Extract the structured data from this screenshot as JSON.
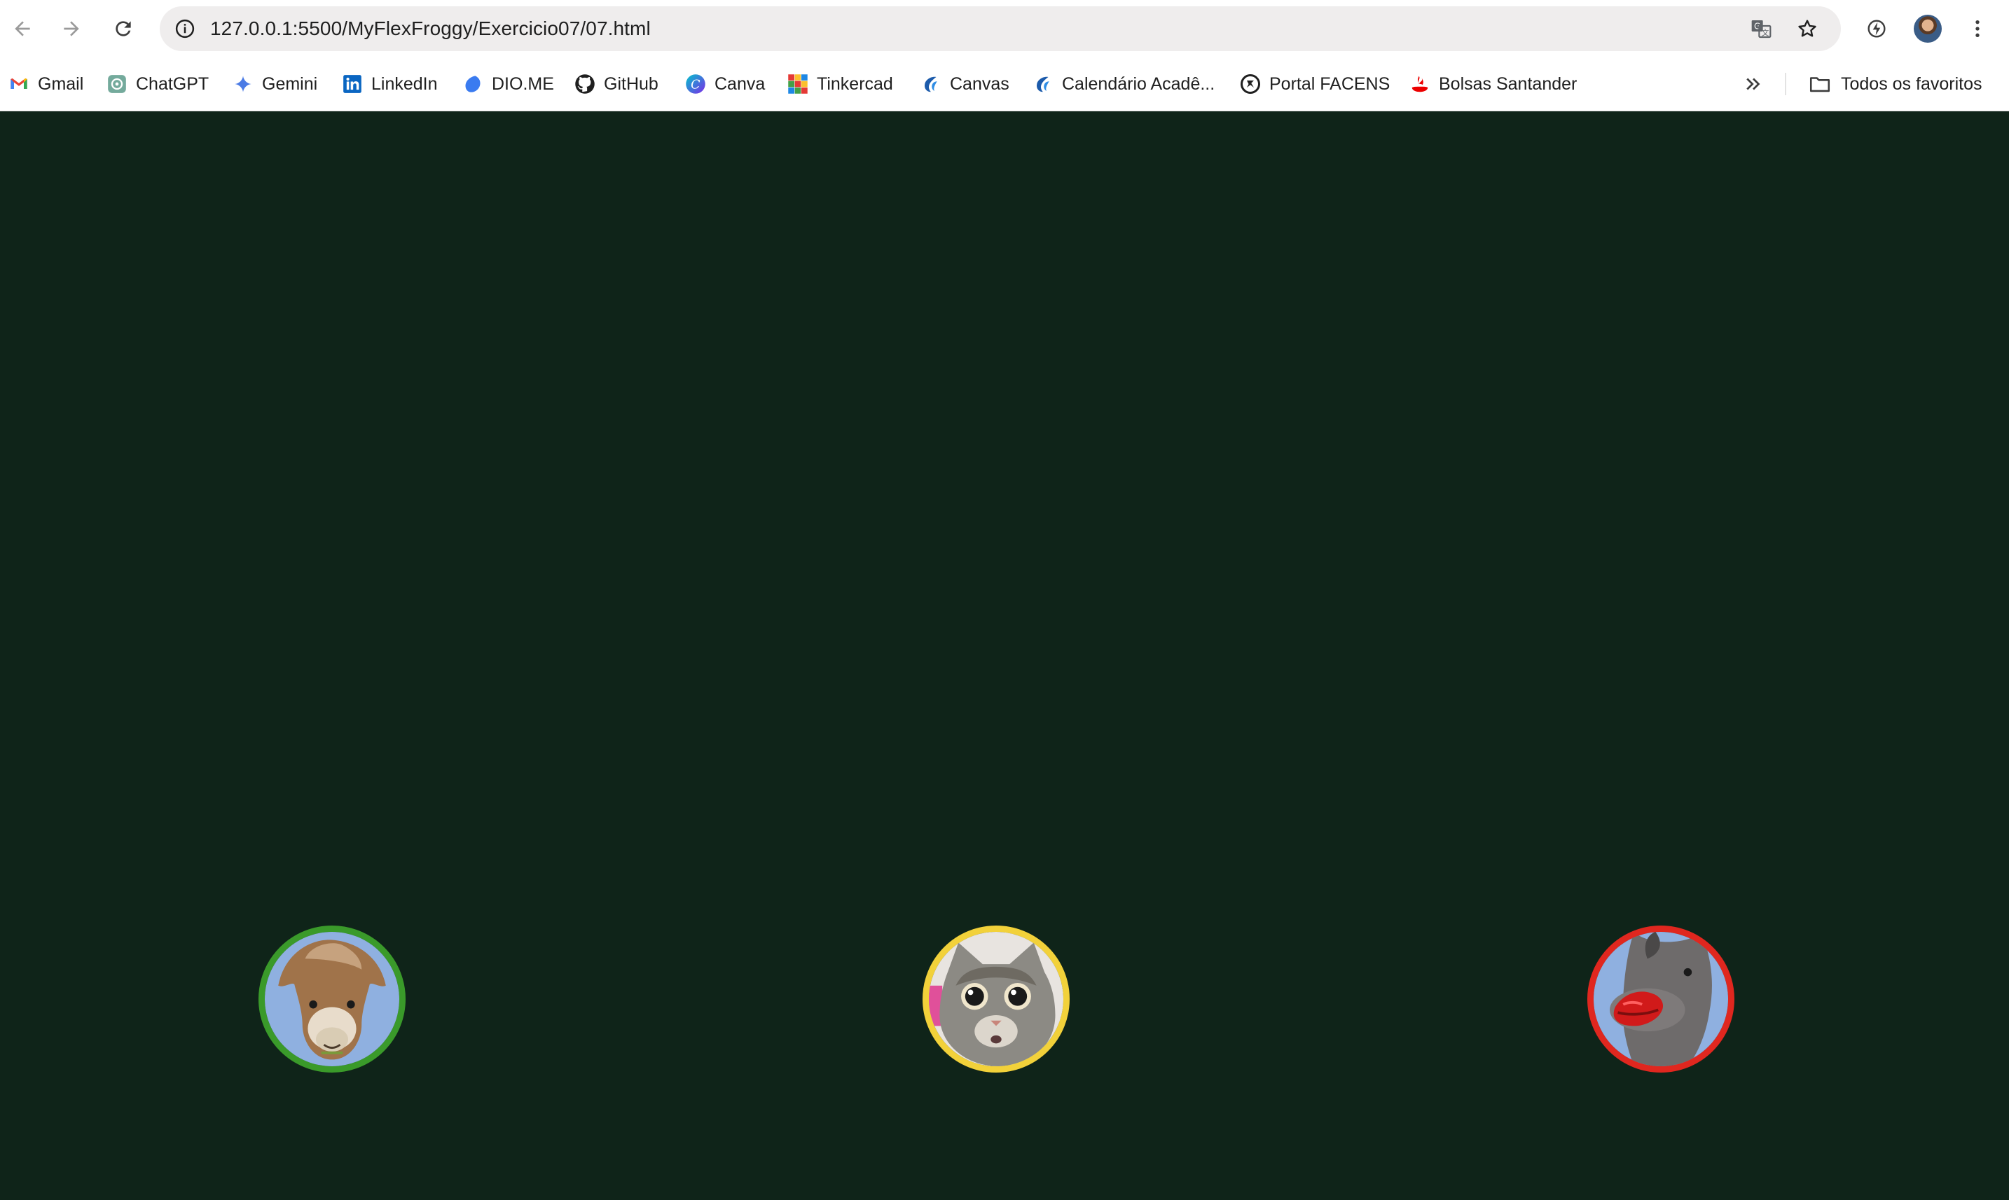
{
  "browser": {
    "url": "127.0.0.1:5500/MyFlexFroggy/Exercicio07/07.html"
  },
  "bookmarks": [
    {
      "label": "Gmail",
      "icon": "gmail-icon"
    },
    {
      "label": "ChatGPT",
      "icon": "chatgpt-icon"
    },
    {
      "label": "Gemini",
      "icon": "gemini-icon"
    },
    {
      "label": "LinkedIn",
      "icon": "linkedin-icon"
    },
    {
      "label": "DIO.ME",
      "icon": "dio-icon"
    },
    {
      "label": "GitHub",
      "icon": "github-icon"
    },
    {
      "label": "Canva",
      "icon": "canva-icon"
    },
    {
      "label": "Tinkercad",
      "icon": "tinkercad-icon"
    },
    {
      "label": "Canvas",
      "icon": "canvas-icon"
    },
    {
      "label": "Calendário Acadê...",
      "icon": "canvas-icon"
    },
    {
      "label": "Portal FACENS",
      "icon": "facens-icon"
    },
    {
      "label": "Bolsas Santander",
      "icon": "santander-icon"
    }
  ],
  "all_bookmarks_label": "Todos os favoritos",
  "page": {
    "background": "#0f2419",
    "frogs": [
      {
        "animal": "llama",
        "border_color": "#3a9a2a"
      },
      {
        "animal": "cat",
        "border_color": "#f2d13a"
      },
      {
        "animal": "horse",
        "border_color": "#e0271f"
      }
    ]
  }
}
